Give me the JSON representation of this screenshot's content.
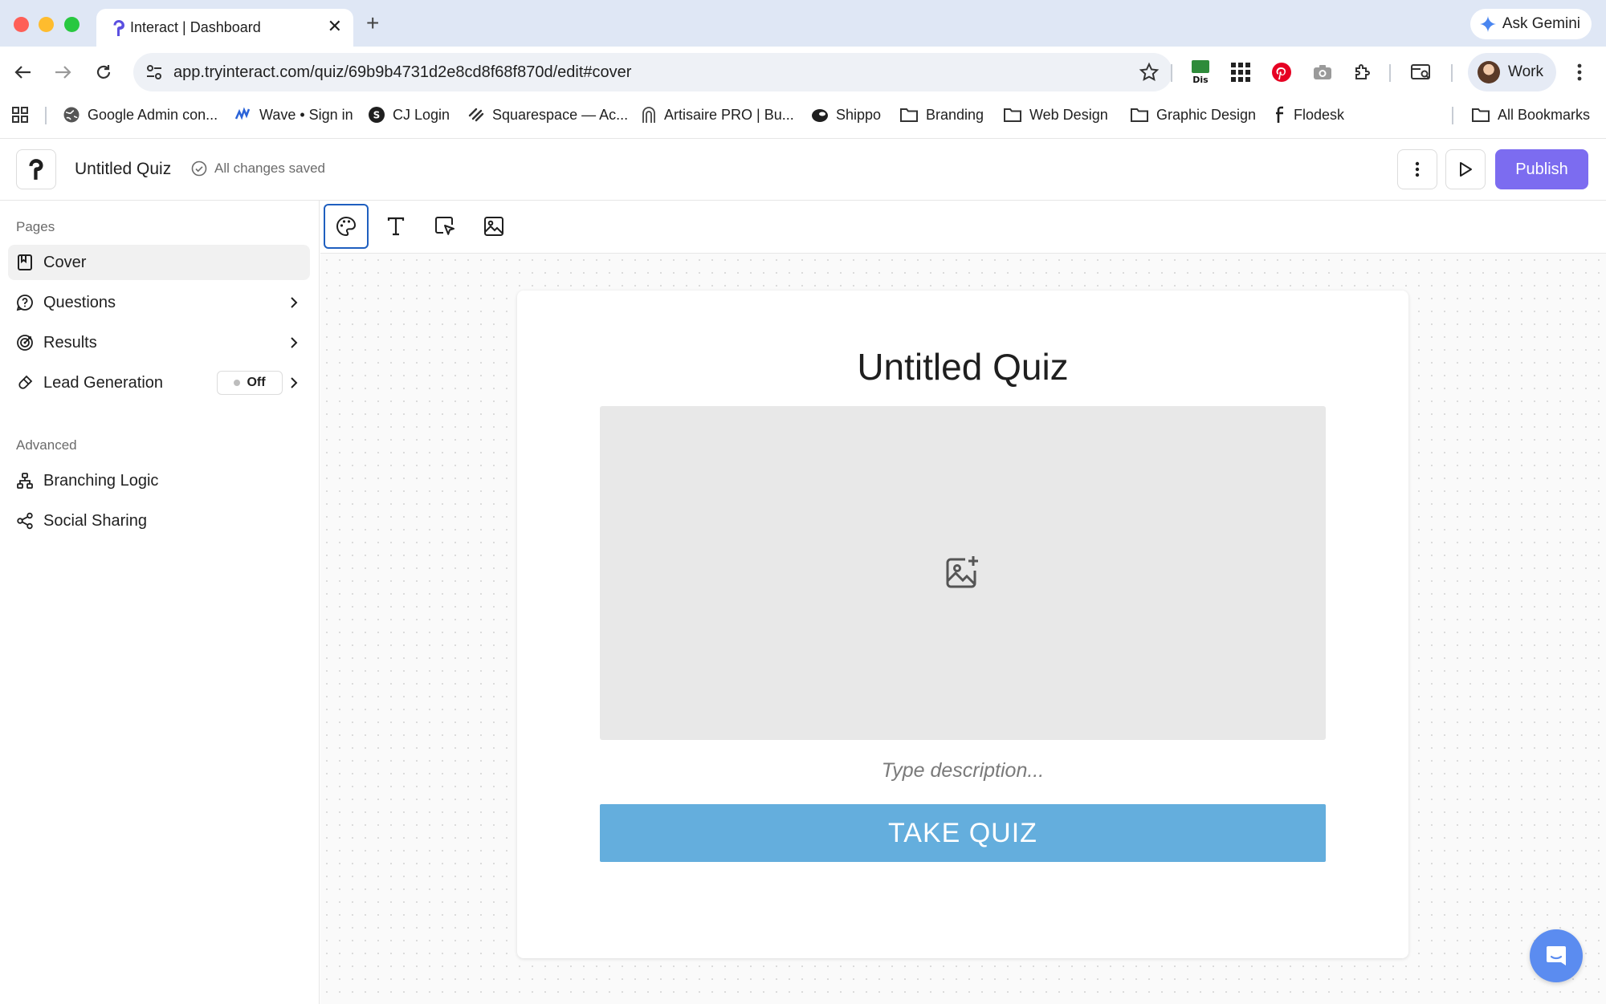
{
  "browser": {
    "tab_title": "Interact | Dashboard",
    "url": "app.tryinteract.com/quiz/69b9b4731d2e8cd8f68f870d/edit#cover",
    "ask_gemini": "Ask Gemini",
    "profile_name": "Work",
    "extension_badge": "Dis",
    "bookmarks": [
      "Google Admin con...",
      "Wave • Sign in",
      "CJ Login",
      "Squarespace — Ac...",
      "Artisaire PRO | Bu...",
      "Shippo",
      "Branding",
      "Web Design",
      "Graphic Design",
      "Flodesk"
    ],
    "all_bookmarks": "All Bookmarks"
  },
  "header": {
    "quiz_title": "Untitled Quiz",
    "save_status": "All changes saved",
    "publish_label": "Publish"
  },
  "sidebar": {
    "pages_label": "Pages",
    "pages": [
      {
        "label": "Cover",
        "active": true
      },
      {
        "label": "Questions"
      },
      {
        "label": "Results"
      },
      {
        "label": "Lead Generation",
        "status": "Off"
      }
    ],
    "advanced_label": "Advanced",
    "advanced": [
      {
        "label": "Branching Logic"
      },
      {
        "label": "Social Sharing"
      }
    ]
  },
  "toolbar": {
    "tools": [
      "palette-icon",
      "text-icon",
      "pointer-icon",
      "image-icon"
    ],
    "active_tool": "palette-icon"
  },
  "cover": {
    "title": "Untitled Quiz",
    "description_placeholder": "Type description...",
    "button_label": "TAKE QUIZ",
    "button_color": "#64aedd"
  },
  "colors": {
    "publish": "#7c6cf0",
    "active_tool_border": "#1f5fbf",
    "chat_widget": "#5b8cf0"
  }
}
